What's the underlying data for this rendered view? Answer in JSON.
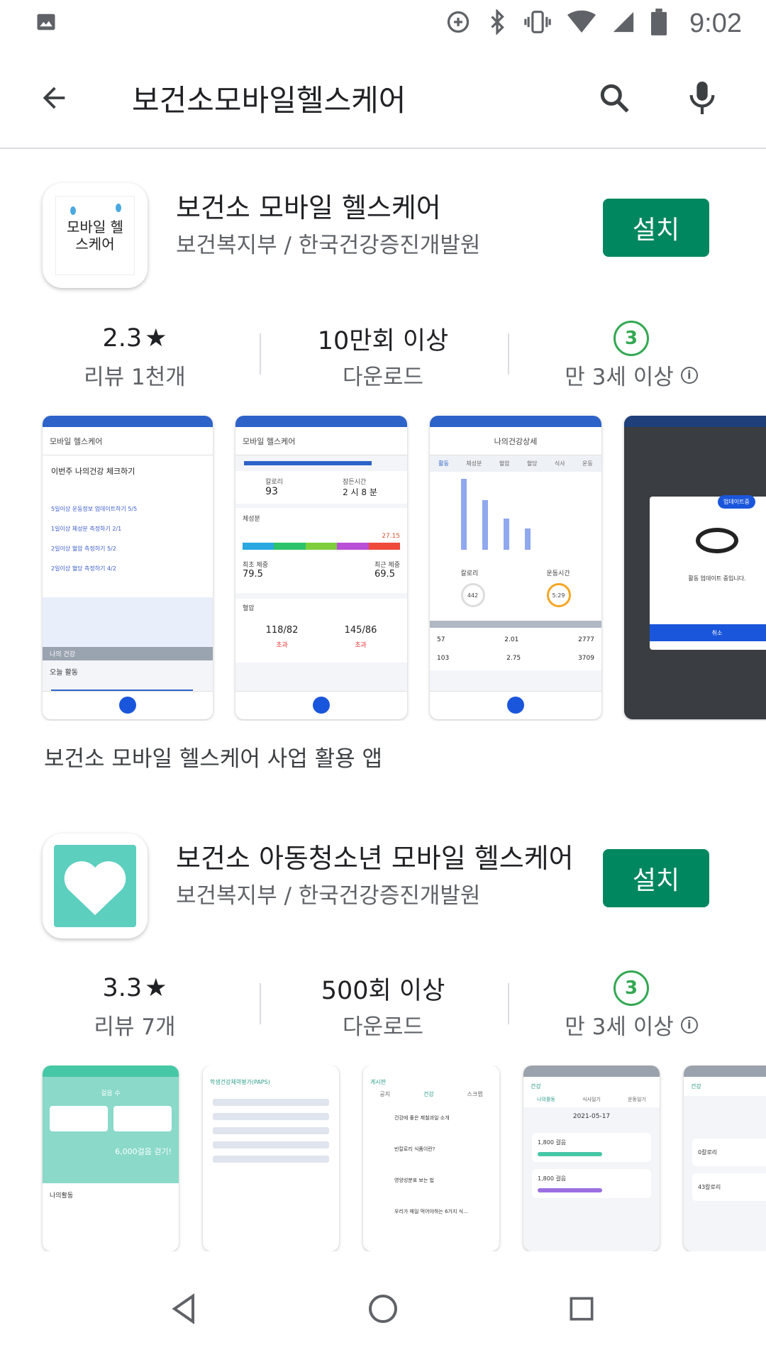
{
  "status_bar": {
    "time": "9:02",
    "icons": [
      "image-icon",
      "data-saver-icon",
      "bluetooth-icon",
      "vibrate-icon",
      "wifi-icon",
      "signal-icon",
      "battery-icon"
    ]
  },
  "search": {
    "query": "보건소모바일헬스케어",
    "icons": [
      "back-arrow-icon",
      "search-icon",
      "mic-icon"
    ]
  },
  "apps": [
    {
      "name": "보건소 모바일 헬스케어",
      "developer": "보건복지부 / 한국건강증진개발원",
      "install_label": "설치",
      "rating": "2.3",
      "rating_star": "★",
      "reviews": "리뷰 1천개",
      "downloads": "10만회 이상",
      "downloads_label": "다운로드",
      "age_rating": "3",
      "age_label": "만 3세 이상",
      "icon_text": "모바일 헬스케어",
      "description": "보건소 모바일 헬스케어 사업 활용 앱"
    },
    {
      "name": "보건소 아동청소년 모바일 헬스케어",
      "developer": "보건복지부 / 한국건강증진개발원",
      "install_label": "설치",
      "rating": "3.3",
      "rating_star": "★",
      "reviews": "리뷰 7개",
      "downloads": "500회 이상",
      "downloads_label": "다운로드",
      "age_rating": "3",
      "age_label": "만 3세 이상"
    }
  ],
  "screenshot_texts": {
    "s1_title": "모바일 헬스케어",
    "s1_heading": "이번주 나의건강 체크하기",
    "s1_items": [
      "5일이상 운동정보 업데이트하기 5/5",
      "1일이상 체성분 측정하기 2/1",
      "2일이상 혈압 측정하기 5/2",
      "2일이상 혈당 측정하기 4/2"
    ],
    "s1_section": "나의 건강",
    "s1_today": "오늘 활동",
    "s2_title": "모바일 헬스케어",
    "s2_cal": "칼로리",
    "s2_cal_val": "93",
    "s2_sleep": "잠든시간",
    "s2_sleep_val": "2 시 8 분",
    "s2_body": "체성분",
    "s2_bmi": "27.15",
    "s2_min": "최초 체중",
    "s2_min_val": "79.5",
    "s2_cur": "최근 체중",
    "s2_cur_val": "69.5",
    "s2_bp": "혈압",
    "s2_bp1": "118/82",
    "s2_bp2": "145/86",
    "s2_exceed": "초과",
    "s3_title": "나의건강상세",
    "s3_tabs": [
      "활동",
      "체성분",
      "혈압",
      "혈당",
      "식사",
      "운동"
    ],
    "s3_cal": "칼로리",
    "s3_exercise": "운동시간",
    "s3_cal_val": "442",
    "s3_time_val": "5:29",
    "s3_rows": [
      "57",
      "2.01",
      "2777",
      "103",
      "2.75",
      "3709"
    ],
    "s4_update": "업데이트중",
    "s4_msg": "활동 업데이트 중입니다.",
    "s4_cancel": "취소",
    "t1_title": "걸음 수",
    "t1_badge": "6,000걸음 걷기!",
    "t1_activity": "나의활동",
    "t2_title": "학생건강체력평가(PAPS)",
    "t3_title": "게시판",
    "t3_tabs": [
      "공지",
      "건강",
      "스크랩"
    ],
    "t3_items": [
      "건강에 좋은 제철과일 소개",
      "빈칼로리 식품이란?",
      "영양성분표 보는 법",
      "우리가 매일 먹어야하는 6가지 식..."
    ],
    "t4_title": "건강",
    "t4_tabs": [
      "나의활동",
      "식사일기",
      "운동일기"
    ],
    "t4_date": "2021-05-17",
    "t4_steps1": "1,800 걸음",
    "t4_steps2": "1,800 걸음",
    "t5_title": "건강",
    "t5_val1": "0칼로리",
    "t5_val2": "43칼로리"
  },
  "nav_bar": {
    "icons": [
      "back-triangle-icon",
      "home-circle-icon",
      "recents-square-icon"
    ]
  },
  "colors": {
    "install_green": "#01875f",
    "age_green": "#34a853",
    "app_blue": "#2d63c8",
    "teal": "#46c7a5"
  }
}
